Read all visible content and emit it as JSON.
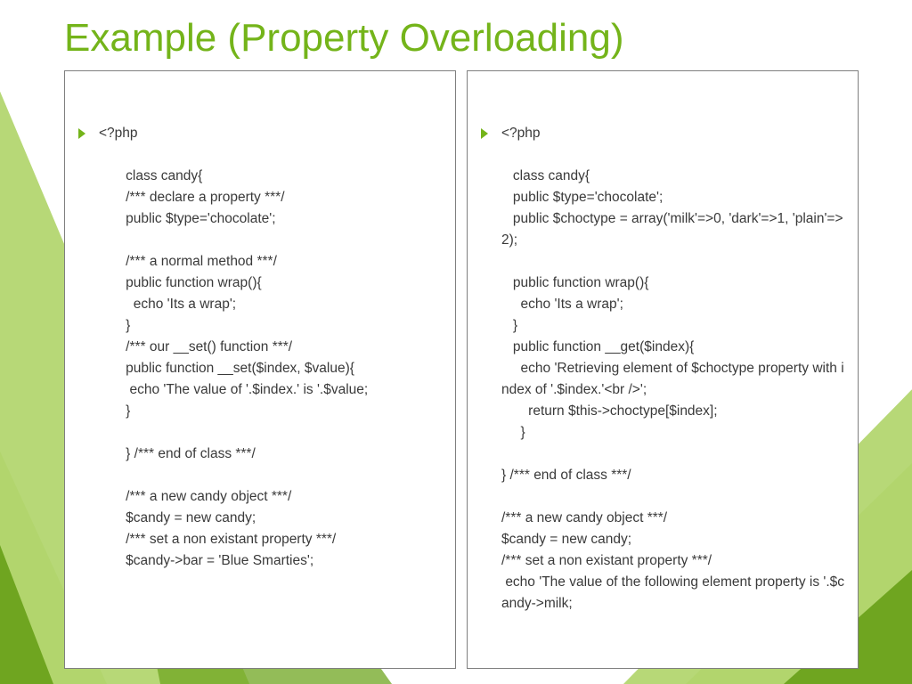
{
  "title": "Example (Property Overloading)",
  "left_code": "<?php\n\n       class candy{\n       /*** declare a property ***/\n       public $type='chocolate';\n\n       /*** a normal method ***/\n       public function wrap(){\n         echo 'Its a wrap';\n       }\n       /*** our __set() function ***/\n       public function __set($index, $value){\n        echo 'The value of '.$index.' is '.$value;\n       }\n\n       } /*** end of class ***/\n\n       /*** a new candy object ***/\n       $candy = new candy;\n       /*** set a non existant property ***/\n       $candy->bar = 'Blue Smarties';",
  "right_code": "<?php\n\n   class candy{\n   public $type='chocolate';\n   public $choctype = array('milk'=>0, 'dark'=>1, 'plain'=>2);\n\n   public function wrap(){\n     echo 'Its a wrap';\n   }\n   public function __get($index){\n     echo 'Retrieving element of $choctype property with index of '.$index.'<br />';\n       return $this->choctype[$index];\n     }\n\n} /*** end of class ***/\n\n/*** a new candy object ***/\n$candy = new candy;\n/*** set a non existant property ***/\n echo 'The value of the following element property is '.$candy->milk;"
}
